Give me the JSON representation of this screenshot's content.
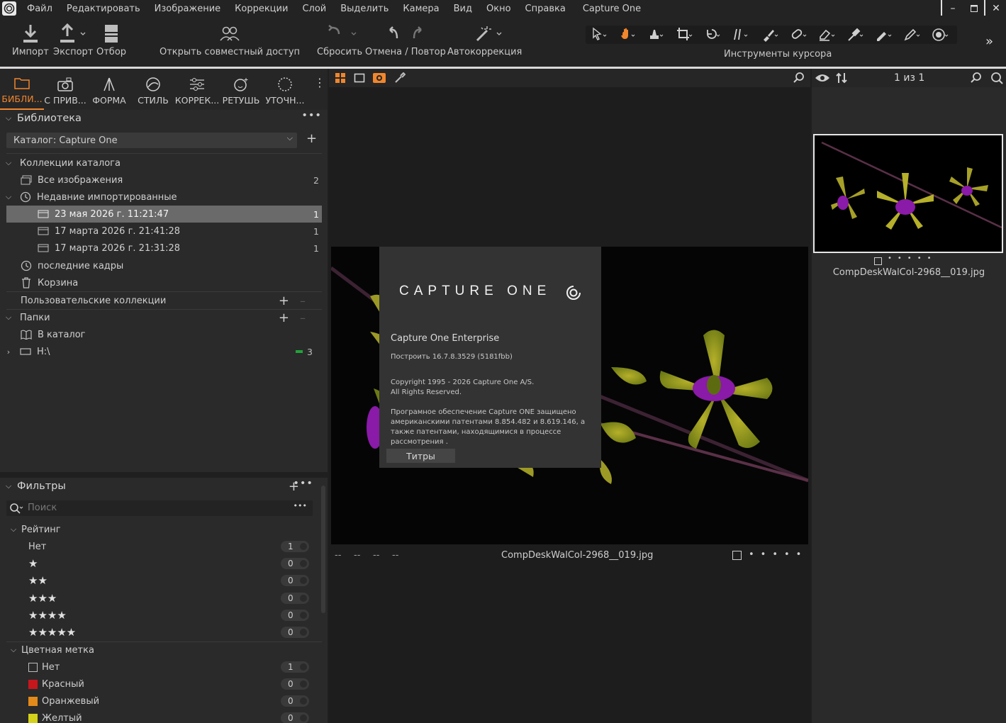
{
  "menu": {
    "items": [
      "Файл",
      "Редактировать",
      "Изображение",
      "Коррекции",
      "Слой",
      "Выделить",
      "Камера",
      "Вид",
      "Окно",
      "Справка"
    ],
    "app_title": "Capture One"
  },
  "toolbar": {
    "import": "Импорт",
    "export": "Экспорт",
    "select": "Отбор",
    "share": "Открыть совместный доступ",
    "reset": "Сбросить",
    "undo_redo": "Отмена / Повтор",
    "auto": "Автокоррекция",
    "cursor_tools": "Инструменты курсора"
  },
  "tool_tabs": [
    "БИБЛИ...",
    "С ПРИВ...",
    "ФОРМА",
    "СТИЛЬ",
    "КОРРЕК...",
    "РЕТУШЬ",
    "УТОЧН..."
  ],
  "library": {
    "title": "Библиотека",
    "catalog": "Каталог: Capture One",
    "collections_header": "Коллекции каталога",
    "all_images": "Все изображения",
    "all_images_count": "2",
    "recent_imports": "Недавние импортированные",
    "imports": [
      {
        "label": "23 мая 2026 г. 11:21:47",
        "count": "1"
      },
      {
        "label": "17 марта 2026 г. 21:41:28",
        "count": "1"
      },
      {
        "label": "17 марта 2026 г. 21:31:28",
        "count": "1"
      }
    ],
    "recent_captures": "последние кадры",
    "trash": "Корзина",
    "user_collections": "Пользовательские коллекции",
    "folders": "Папки",
    "in_catalog": "В каталог",
    "drive": "H:\\",
    "drive_count": "3"
  },
  "filters": {
    "title": "Фильтры",
    "search_placeholder": "Поиск",
    "rating_header": "Рейтинг",
    "rating_none": "Нет",
    "ratings": [
      {
        "stars": "",
        "count": "1"
      },
      {
        "stars": "★",
        "count": "0"
      },
      {
        "stars": "★★",
        "count": "0"
      },
      {
        "stars": "★★★",
        "count": "0"
      },
      {
        "stars": "★★★★",
        "count": "0"
      },
      {
        "stars": "★★★★★",
        "count": "0"
      }
    ],
    "color_header": "Цветная метка",
    "colors": [
      {
        "label": "Нет",
        "count": "1",
        "swatch": "none"
      },
      {
        "label": "Красный",
        "count": "0",
        "swatch": "#c8161d"
      },
      {
        "label": "Оранжевый",
        "count": "0",
        "swatch": "#e38a1a"
      },
      {
        "label": "Желтый",
        "count": "0",
        "swatch": "#d4d11b"
      }
    ]
  },
  "about": {
    "brand": "CAPTURE ONE",
    "product": "Capture One Enterprise",
    "build": "Построить 16.7.8.3529 (5181fbb)",
    "copyright": "Copyright 1995 - 2026 Capture One A/S.",
    "rights": "All Rights Reserved.",
    "patent": "Програмное обеспечение Capture ONE защищено американскими патентами   8.854.482 и 8.619.146, а также патентами, находящимися в процессе рассмотрения .",
    "credits": "Титры"
  },
  "viewer": {
    "filename": "CompDeskWalCol-2968__019.jpg",
    "meta": [
      "--",
      "--",
      "--",
      "--"
    ]
  },
  "browser": {
    "count": "1 из 1",
    "filename": "CompDeskWalCol-2968__019.jpg"
  },
  "colors": {
    "accent": "#f0862d",
    "selected_row": "#6a6a6a",
    "folder_badge": "#1fa33a"
  }
}
